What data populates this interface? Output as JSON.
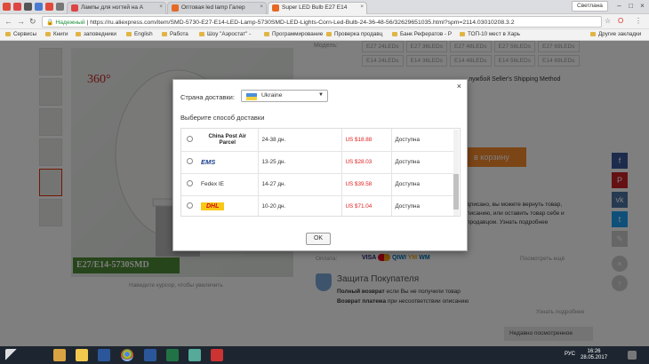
{
  "browser": {
    "tabs": [
      {
        "label": "Лампы для ногтей на А"
      },
      {
        "label": "Оптовая led lamp Галер"
      },
      {
        "label": "Super LED Bulb E27 E14"
      }
    ],
    "profile": "Светлана",
    "security_label": "Надежный",
    "url": "https://ru.aliexpress.com/item/SMD-5730-E27-E14-LED-Lamp-5730SMD-LED-Lights-Corn-Led-Bulb-24-36-48-56/32629651035.html?spm=2114.03010208.3.2",
    "bookmarks": [
      "Сервисы",
      "Книги",
      "заповедники",
      "English",
      "Работа",
      "Шоу \"Аэростат\" -",
      "Программирование",
      "Проверка продавц",
      "Банк Рефератов - Р",
      "ТОП-10 мест в Харь",
      "Другие закладки"
    ]
  },
  "product": {
    "badge": "360°",
    "label": "E27/E14-5730SMD",
    "hover_hint": "Наведите курсор, чтобы увеличить"
  },
  "right": {
    "model_label": "Модель:",
    "models_row1": [
      "E27 24LEDs",
      "E27 36LEDs",
      "E27 48LEDs",
      "E27 56LEDs",
      "E27 69LEDs"
    ],
    "models_row2": [
      "E14 24LEDs",
      "E14 36LEDs",
      "E14 48LEDs",
      "E14 56LEDs",
      "E14 69LEDs"
    ],
    "shipping_method": "лужбой Seller's Shipping Method",
    "cart_button": "в корзину",
    "return_text1": "дписано, вы можете вернуть товар,",
    "return_text2": "писанию, или оставить товар себе и",
    "return_text3": "продавцом. Узнать подробнее",
    "payment_label": "Оплата:",
    "payment_more": "Посмотреть ещё",
    "protection_title": "Защита Покупателя",
    "protection_line1_bold": "Полный возврат",
    "protection_line1": "если Вы не получили товар",
    "protection_line2_bold": "Возврат платежа",
    "protection_line2": "при несоответствии описанию",
    "learn_more": "Узнать подробнее",
    "recently_viewed": "Недавно посмотренное"
  },
  "dialog": {
    "country_label": "Страна доставки:",
    "country_value": "Ukraine",
    "method_label": "Выберите способ доставки",
    "rows": [
      {
        "carrier": "China Post Air Parcel",
        "days": "24-38 дн.",
        "price": "US $18.88",
        "status": "Доступна"
      },
      {
        "carrier": "EMS",
        "days": "13-25 дн.",
        "price": "US $28.03",
        "status": "Доступна"
      },
      {
        "carrier": "Fedex IE",
        "days": "14-27 дн.",
        "price": "US $39.58",
        "status": "Доступна"
      },
      {
        "carrier": "DHL",
        "days": "10-20 дн.",
        "price": "US $71.04",
        "status": "Доступна"
      }
    ],
    "ok_label": "OK",
    "close_glyph": "×"
  },
  "taskbar": {
    "lang": "РУС",
    "time": "16:26",
    "date": "28.05.2017"
  }
}
